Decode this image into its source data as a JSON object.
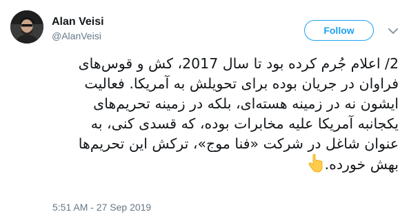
{
  "author": {
    "display_name": "Alan Veisi",
    "handle": "@AlanVeisi"
  },
  "follow_label": "Follow",
  "tweet": {
    "text": "2/ اعلام جُرم کرده بود تا سال 2017، کش و قوس‌های\nفراوان در جریان بوده برای تحویلش به آمریکا. فعالیت\nایشون نه در زمینه هسته‌ای، بلکه در زمینه تحریم‌های\nیکجانبه آمریکا علیه مخابرات بوده، که قسدی کنی، به\nعنوان شاغل در شرکت «فنا موج»، ترکش این تحریم‌ها\nبهش خورده.",
    "emoji_icon": "pointing-down-hand-icon"
  },
  "timestamp": "5:51 AM - 27 Sep 2019",
  "colors": {
    "accent": "#1da1f2",
    "secondary_text": "#657786",
    "primary_text": "#14171a"
  }
}
